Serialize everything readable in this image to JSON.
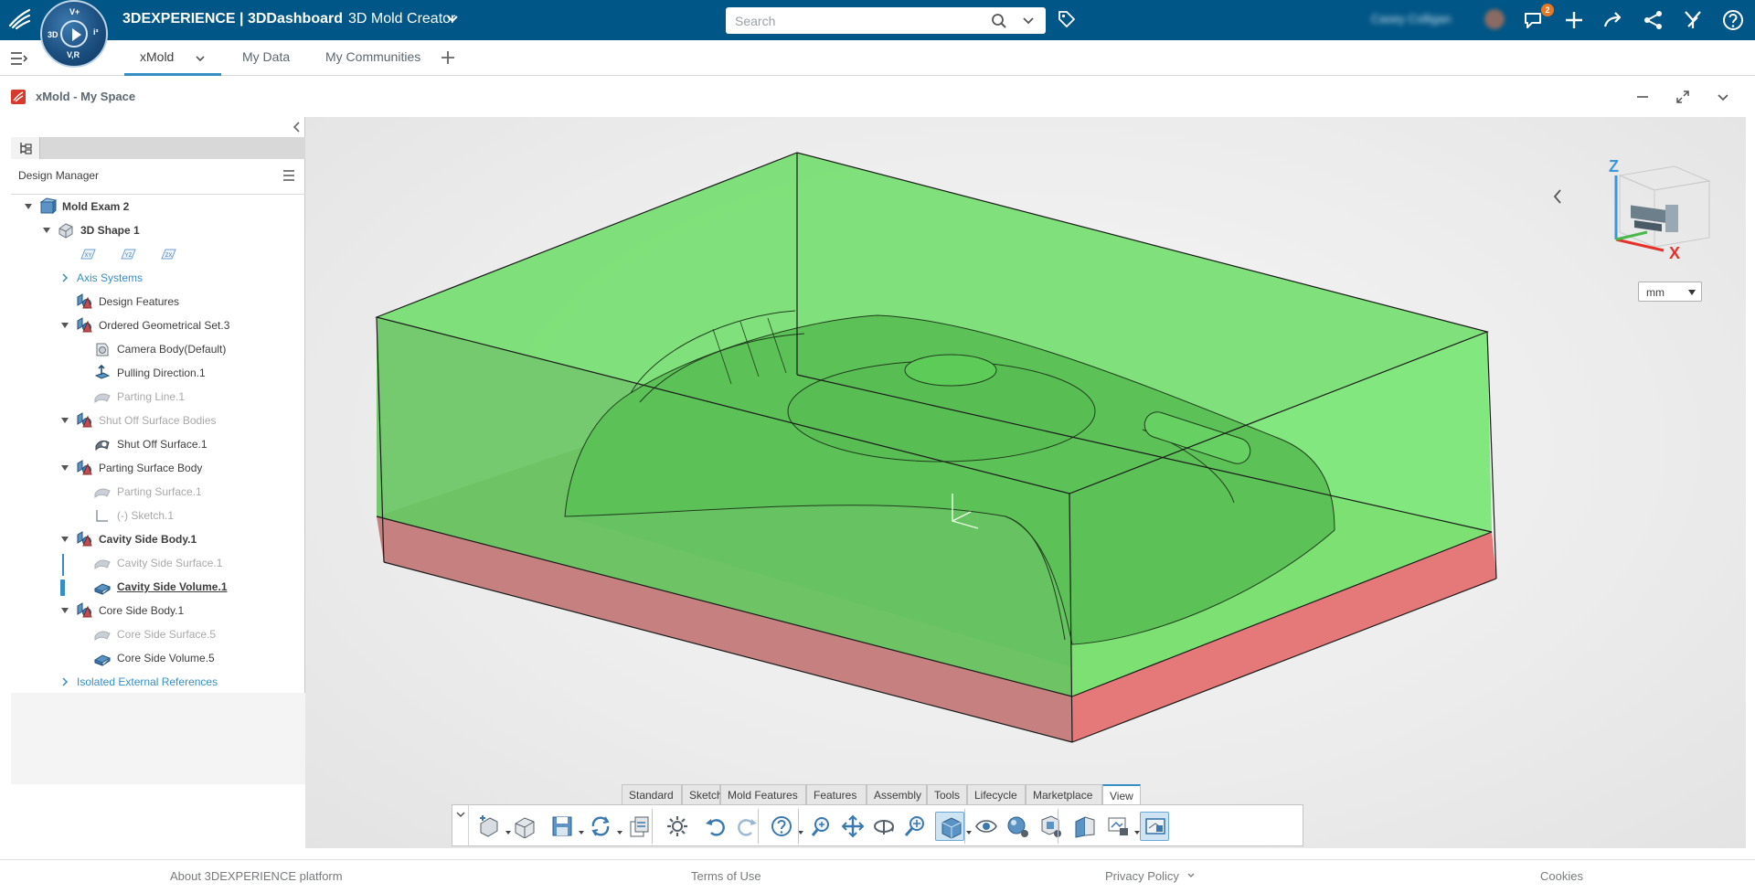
{
  "topbar": {
    "brand_bold": "3DEXPERIENCE | 3DDashboard",
    "app_name": "3D Mold Creator",
    "compass_labels": {
      "top": "V+",
      "left": "3D",
      "right": "i³",
      "bottom": "V,R"
    },
    "search_placeholder": "Search",
    "username": "Casey Colligan",
    "notification_count": "2",
    "brand_color": "#005686"
  },
  "tabs": {
    "items": [
      {
        "label": "xMold",
        "active": true
      },
      {
        "label": "My Data",
        "active": false
      },
      {
        "label": "My Communities",
        "active": false
      }
    ]
  },
  "widget": {
    "title": "xMold - My Space"
  },
  "design_manager": {
    "title": "Design Manager",
    "tree": [
      {
        "label": "Mold Exam 2",
        "level": 0,
        "toggle": "expanded",
        "icon": "product-icon",
        "style": "bold"
      },
      {
        "label": "3D Shape 1",
        "level": 1,
        "toggle": "expanded",
        "icon": "shape-icon",
        "style": "bold"
      },
      {
        "label": "",
        "level": 2,
        "toggle": "none",
        "icon": "planes-icon",
        "style": "planes",
        "planes": [
          "XY",
          "YZ",
          "ZX"
        ]
      },
      {
        "label": "Axis Systems",
        "level": 2,
        "toggle": "collapsed",
        "icon": "none",
        "style": "blue"
      },
      {
        "label": "Design Features",
        "level": 2,
        "toggle": "none",
        "icon": "set-icon",
        "style": "normal"
      },
      {
        "label": "Ordered Geometrical Set.3",
        "level": 2,
        "toggle": "expanded",
        "icon": "set-icon",
        "style": "normal"
      },
      {
        "label": "Camera Body(Default)",
        "level": 3,
        "toggle": "none",
        "icon": "body-icon",
        "style": "normal"
      },
      {
        "label": "Pulling Direction.1",
        "level": 3,
        "toggle": "none",
        "icon": "direction-icon",
        "style": "normal"
      },
      {
        "label": "Parting Line.1",
        "level": 3,
        "toggle": "none",
        "icon": "surface-icon",
        "style": "dim"
      },
      {
        "label": "Shut Off Surface Bodies",
        "level": 2,
        "toggle": "expanded",
        "icon": "set-icon",
        "style": "dim"
      },
      {
        "label": "Shut Off Surface.1",
        "level": 3,
        "toggle": "none",
        "icon": "shutoff-icon",
        "style": "normal"
      },
      {
        "label": "Parting Surface Body",
        "level": 2,
        "toggle": "expanded",
        "icon": "set-icon",
        "style": "normal"
      },
      {
        "label": "Parting Surface.1",
        "level": 3,
        "toggle": "none",
        "icon": "surface-icon",
        "style": "dim"
      },
      {
        "label": "(-)   Sketch.1",
        "level": 3,
        "toggle": "none",
        "icon": "sketch-icon",
        "style": "dim"
      },
      {
        "label": "Cavity Side Body.1",
        "level": 2,
        "toggle": "expanded",
        "icon": "set-icon",
        "style": "bold"
      },
      {
        "label": "Cavity Side Surface.1",
        "level": 3,
        "toggle": "none",
        "icon": "surface-icon",
        "style": "dim"
      },
      {
        "label": "Cavity Side Volume.1",
        "level": 3,
        "toggle": "none",
        "icon": "volume-icon",
        "style": "current"
      },
      {
        "label": "Core Side Body.1",
        "level": 2,
        "toggle": "expanded",
        "icon": "set-icon",
        "style": "normal"
      },
      {
        "label": "Core Side Surface.5",
        "level": 3,
        "toggle": "none",
        "icon": "surface-icon",
        "style": "dim"
      },
      {
        "label": "Core Side Volume.5",
        "level": 3,
        "toggle": "none",
        "icon": "volume-icon",
        "style": "normal"
      },
      {
        "label": "Isolated External References",
        "level": 2,
        "toggle": "collapsed",
        "icon": "none",
        "style": "blue"
      }
    ]
  },
  "viewport": {
    "axis_labels": {
      "z": "Z",
      "x": "X"
    },
    "unit": "mm",
    "colors": {
      "cavity": "#6ee06a",
      "core": "#e57373",
      "edge": "#1a1a1a"
    }
  },
  "action_bar": {
    "tabs": [
      "Standard",
      "Sketch",
      "Mold Features",
      "Features",
      "Assembly",
      "Tools",
      "Lifecycle",
      "Marketplace",
      "View"
    ],
    "active_tab": "View",
    "tools": [
      "new-sketch-icon",
      "shape-icon",
      "save-icon",
      "refresh-icon",
      "replace-icon",
      "settings-icon",
      "undo-icon",
      "redo-icon",
      "help-icon",
      "fit-all-icon",
      "pan-icon",
      "rotate-icon",
      "zoom-icon",
      "view-mode-icon",
      "hide-show-icon",
      "render-icon",
      "lighting-icon",
      "section-icon",
      "capture-icon",
      "display-icon"
    ]
  },
  "footer": {
    "links": [
      "About 3DEXPERIENCE platform",
      "Terms of Use",
      "Privacy Policy",
      "Cookies"
    ]
  }
}
